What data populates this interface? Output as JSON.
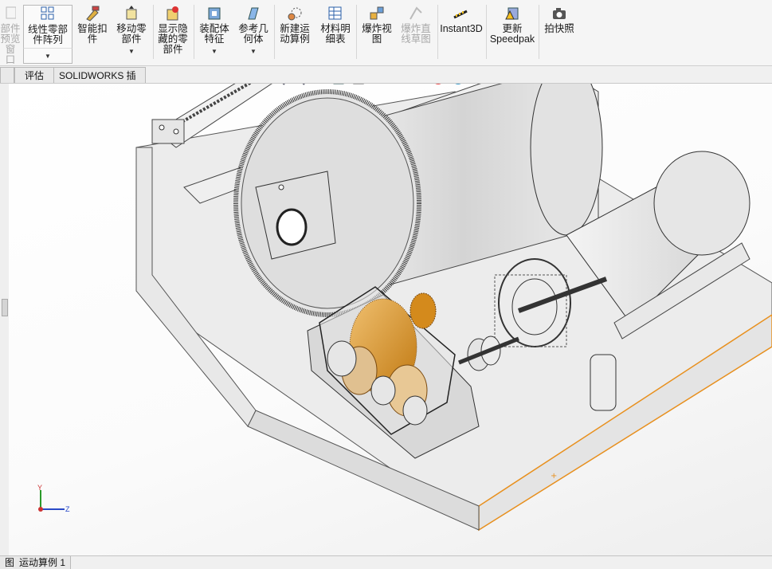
{
  "ribbon": {
    "buttons": [
      {
        "id": "component-preview",
        "label": "部件\n预览窗\n口",
        "disabled": true
      },
      {
        "id": "linear-pattern",
        "label": "线性零部\n件阵列",
        "disabled": false
      },
      {
        "id": "smart-fasteners",
        "label": "智能扣\n件",
        "disabled": false
      },
      {
        "id": "move-component",
        "label": "移动零\n部件",
        "disabled": false
      },
      {
        "id": "show-hidden",
        "label": "显示隐\n藏的零\n部件",
        "disabled": false
      },
      {
        "id": "assembly-features",
        "label": "装配体\n特征",
        "disabled": false
      },
      {
        "id": "reference-geometry",
        "label": "参考几\n何体",
        "disabled": false
      },
      {
        "id": "new-motion-study",
        "label": "新建运\n动算例",
        "disabled": false
      },
      {
        "id": "bill-of-materials",
        "label": "材料明\n细表",
        "disabled": false
      },
      {
        "id": "exploded-view",
        "label": "爆炸视\n图",
        "disabled": false
      },
      {
        "id": "explode-line-sketch",
        "label": "爆炸直\n线草图",
        "disabled": true
      },
      {
        "id": "instant3d",
        "label": "Instant3D",
        "disabled": false
      },
      {
        "id": "update-speedpak",
        "label": "更新\nSpeedpak",
        "disabled": false
      },
      {
        "id": "take-snapshot",
        "label": "拍快照",
        "disabled": false
      }
    ]
  },
  "tabs": [
    {
      "id": "evaluate",
      "label": "评估"
    },
    {
      "id": "solidworks-addins",
      "label": "SOLIDWORKS 插件"
    }
  ],
  "bottom_tabs": [
    {
      "id": "model",
      "label": "图"
    },
    {
      "id": "motion-study",
      "label": "运动算例 1"
    }
  ],
  "triad": {
    "y": "Y",
    "z": "Z"
  },
  "colors": {
    "accent": "#e8901e",
    "gear": "#d48a1c",
    "model_gray": "#d9d9d9"
  }
}
